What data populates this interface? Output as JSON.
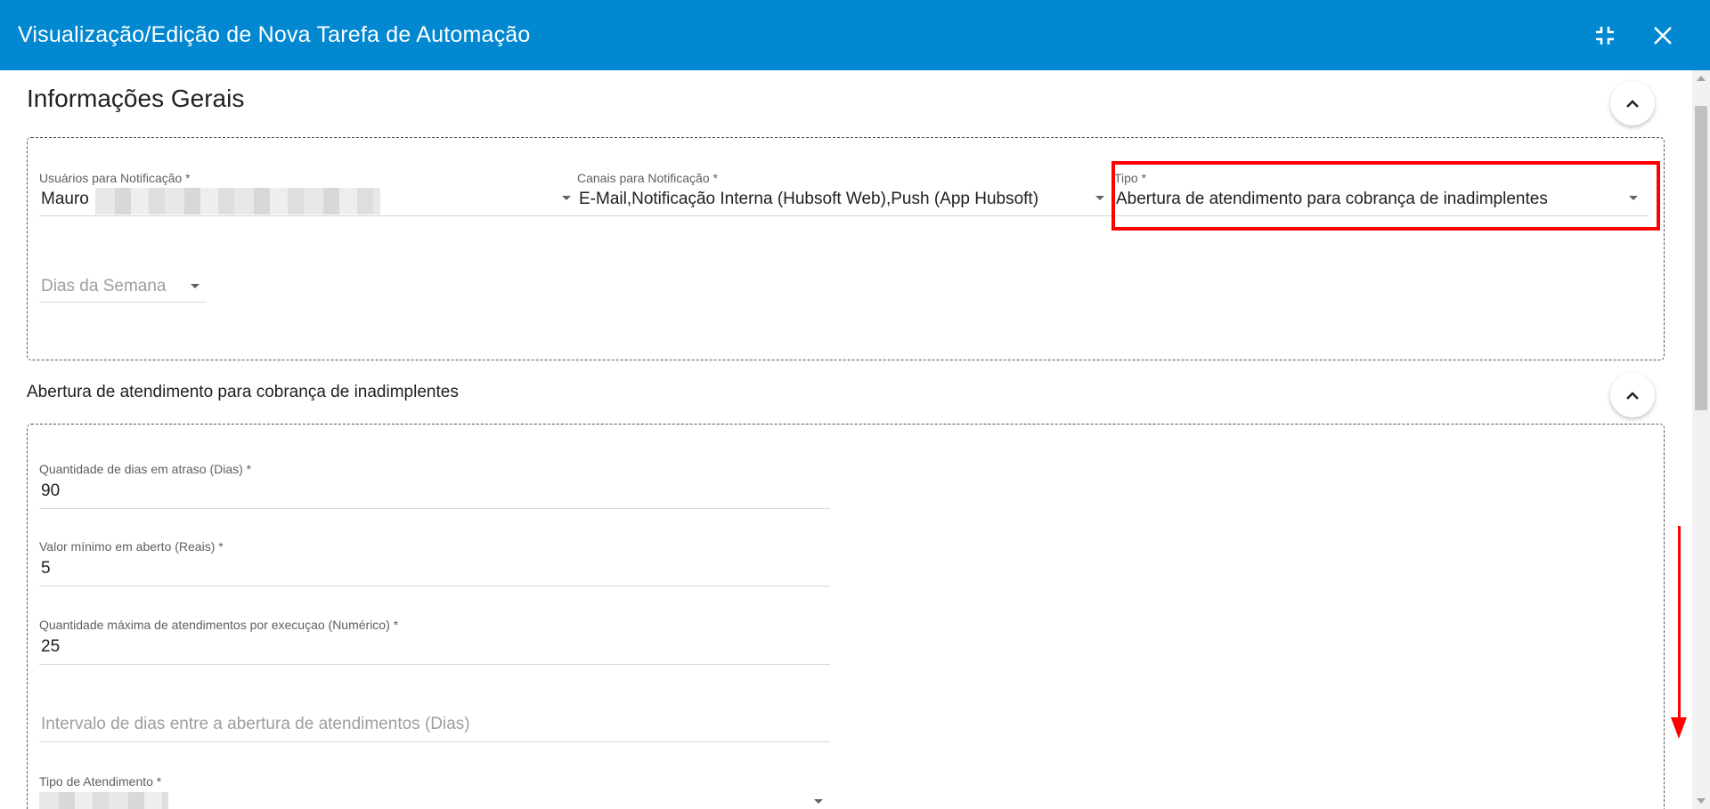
{
  "dialog": {
    "title": "Visualização/Edição de Nova Tarefa de Automação",
    "minimize_icon": "compress-icon",
    "close_icon": "close-icon"
  },
  "general": {
    "title": "Informações Gerais",
    "users": {
      "label": "Usuários para Notificação *",
      "value": "Mauro"
    },
    "channels": {
      "label": "Canais para Notificação *",
      "value": "E-Mail,Notificação Interna (Hubsoft Web),Push (App Hubsoft)"
    },
    "type": {
      "label": "Tipo *",
      "value": "Abertura de atendimento para cobrança de inadimplentes"
    },
    "weekdays": {
      "placeholder": "Dias da Semana"
    }
  },
  "billing": {
    "title": "Abertura de atendimento para cobrança de inadimplentes",
    "days_late": {
      "label": "Quantidade de dias em atraso (Dias) *",
      "value": "90"
    },
    "min_value": {
      "label": "Valor mínimo em aberto (Reais) *",
      "value": "5"
    },
    "max_tickets": {
      "label": "Quantidade máxima de atendimentos por execuçao (Numérico) *",
      "value": "25"
    },
    "interval": {
      "placeholder": "Intervalo de dias entre a abertura de atendimentos (Dias)"
    },
    "ticket_type": {
      "label": "Tipo de Atendimento *"
    }
  },
  "colors": {
    "header": "#0288d1",
    "highlight": "#ff0000"
  }
}
